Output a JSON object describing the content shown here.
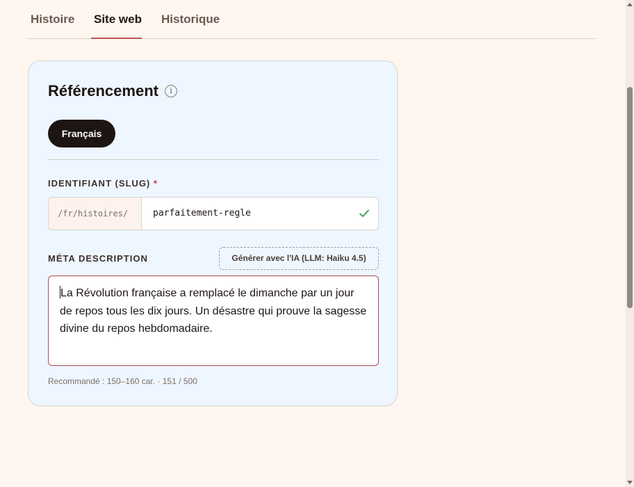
{
  "tabs": [
    {
      "label": "Histoire"
    },
    {
      "label": "Site web"
    },
    {
      "label": "Historique"
    }
  ],
  "active_tab": "Site web",
  "seo": {
    "title": "Référencement",
    "info_icon": "i",
    "language": "Français",
    "slug": {
      "label": "IDENTIFIANT (SLUG)",
      "required_mark": "*",
      "prefix": "/fr/histoires/",
      "value": "parfaitement-regle"
    },
    "meta": {
      "label": "MÉTA DESCRIPTION",
      "ai_button": "Générer avec l'IA (LLM: Haiku 4.5)",
      "value": "La Révolution française a remplacé le dimanche par un jour de repos tous les dix jours. Un désastre qui prouve la sagesse divine du repos hebdomadaire.",
      "counter": "Recommandé : 150–160 car. · 151 / 500"
    }
  },
  "colors": {
    "background": "#fff6f0",
    "card": "#eef6ff",
    "accent": "#b9574a",
    "dark": "#1d1512",
    "check": "#3a9a4f",
    "error_border": "#b04a55"
  },
  "icons": {
    "info": "info-icon",
    "check": "check-icon"
  }
}
